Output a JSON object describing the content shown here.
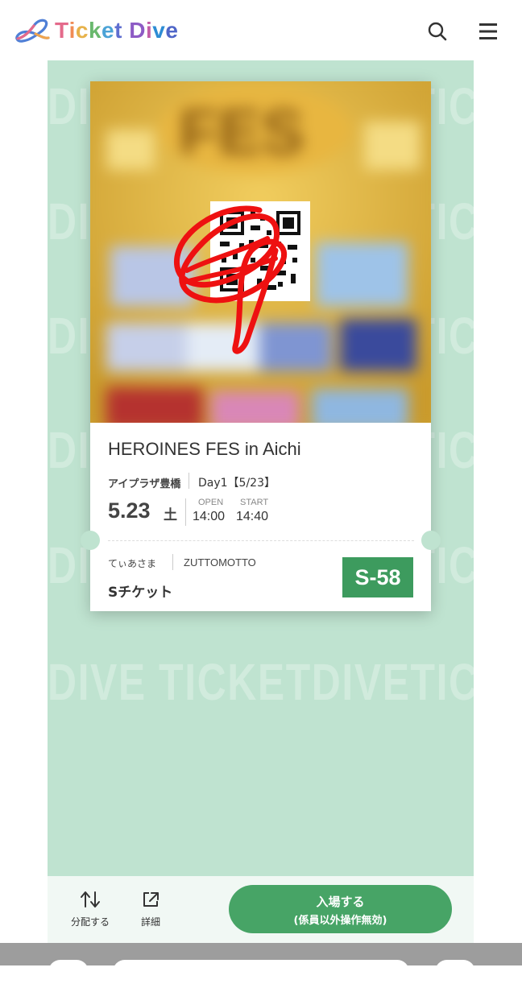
{
  "header": {
    "brand": "Ticket Dive",
    "brand_colors": [
      "#e46a8b",
      "#f08c55",
      "#e7b24a",
      "#69b86d",
      "#4ba3d6",
      "#5f6ed0",
      "#8d5bc5",
      "#c35ea8",
      "#2d8cd4",
      "#4f66c8"
    ],
    "icons": [
      "search-icon",
      "hamburger-menu-icon"
    ]
  },
  "watermark": {
    "text": "DIVE TICKETDIVETICKET"
  },
  "ticket": {
    "title": "HEROINES FES in Aichi",
    "venue": "アイプラザ豊橋",
    "day": "Day1【5/23】",
    "date": "5.23",
    "weekday": "土",
    "open_label": "OPEN",
    "open_time": "14:00",
    "start_label": "START",
    "start_time": "14:40",
    "holder": "てぃあさま",
    "group": "ZUTTOMOTTO",
    "ticket_type": "Sチケット",
    "seat": "S-58",
    "seat_color": "#3d9b5e"
  },
  "actions": {
    "transfer_label": "分配する",
    "detail_label": "詳細",
    "enter_label": "入場する",
    "enter_note": "(係員以外操作無効)",
    "enter_color": "#47a466"
  },
  "colors": {
    "background": "#bfe3d0",
    "action_bar": "#f1f8f4"
  }
}
